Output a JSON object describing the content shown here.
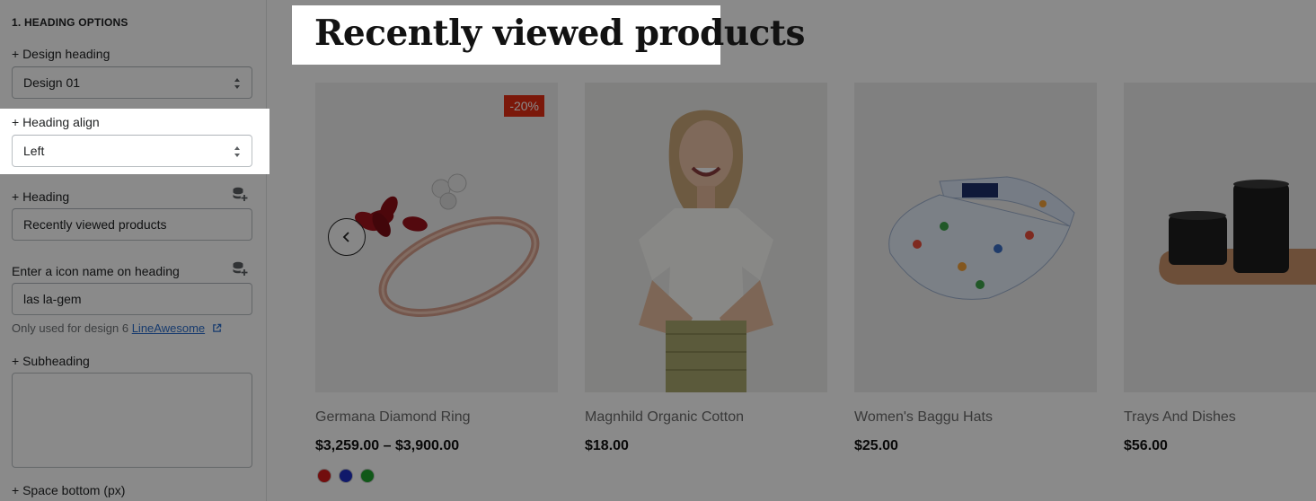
{
  "sidebar": {
    "section_title": "1. HEADING OPTIONS",
    "design_heading": {
      "label": "+ Design heading",
      "value": "Design 01"
    },
    "heading_align": {
      "label": "+ Heading align",
      "value": "Left"
    },
    "heading": {
      "label": "+ Heading",
      "value": "Recently viewed products"
    },
    "icon_name": {
      "label": "Enter a icon name on heading",
      "value": "las la-gem",
      "help_prefix": "Only used for design 6",
      "help_link": "LineAwesome"
    },
    "subheading": {
      "label": "+ Subheading",
      "value": ""
    },
    "space_bottom": {
      "label": "+ Space bottom (px)"
    }
  },
  "preview": {
    "heading": "Recently viewed products",
    "products": [
      {
        "title": "Germana Diamond Ring",
        "price": "$3,259.00 – $3,900.00",
        "badge": "-20%",
        "swatches": [
          "#d21a1a",
          "#1f2fc4",
          "#1fa32e"
        ]
      },
      {
        "title": "Magnhild Organic Cotton",
        "price": "$18.00"
      },
      {
        "title": "Women's Baggu Hats",
        "price": "$25.00"
      },
      {
        "title": "Trays And Dishes",
        "price": "$56.00"
      }
    ]
  },
  "icons": {
    "select_caret": "updown-caret-icon",
    "dynamic_source": "database-plus-icon",
    "external_link": "external-link-icon",
    "carousel_prev": "chevron-left-icon"
  },
  "colors": {
    "sale_badge": "#e42d14",
    "link": "#2c6ecb",
    "overlay": "rgba(0,0,0,0.46)"
  }
}
